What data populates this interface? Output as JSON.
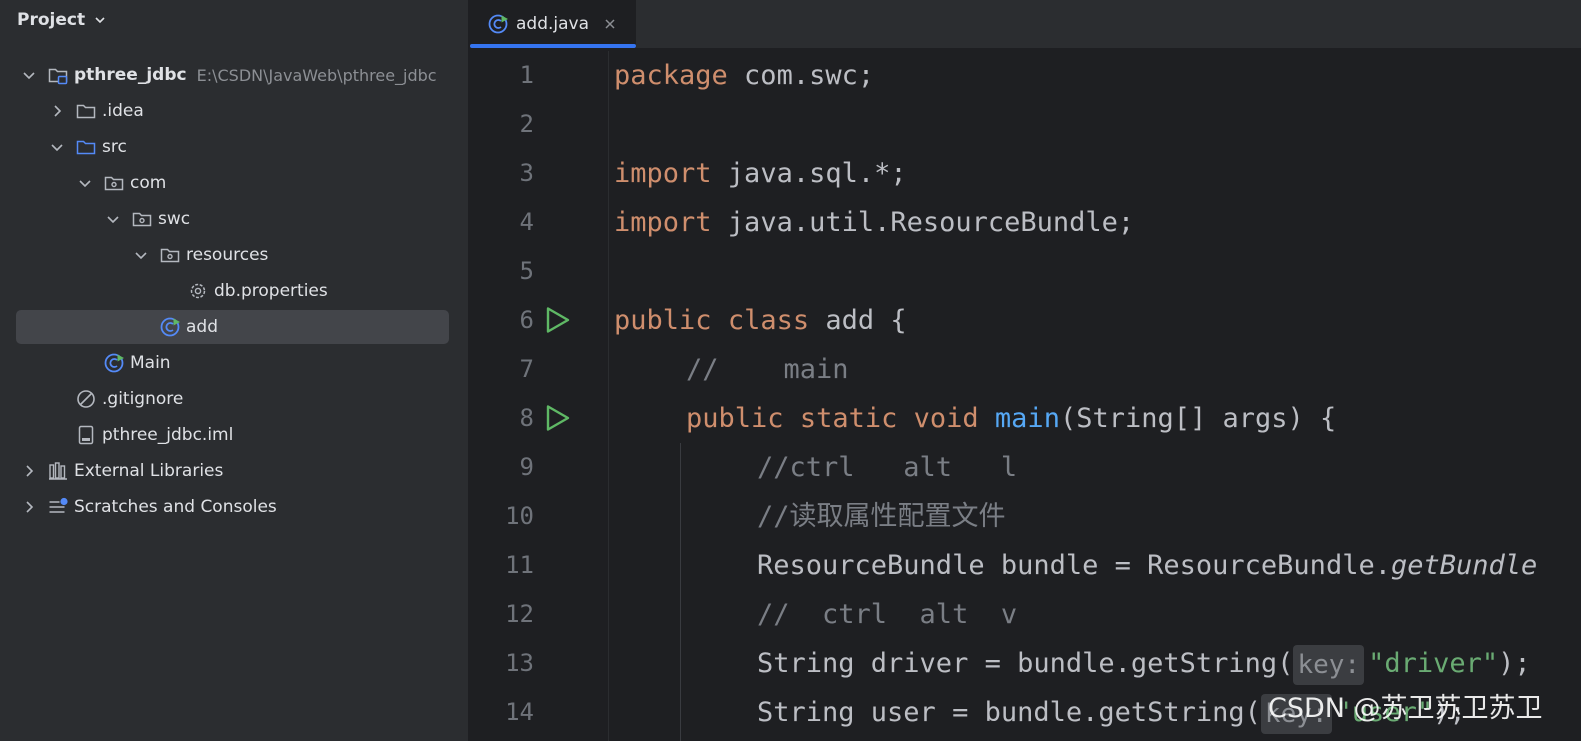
{
  "project_panel": {
    "title": "Project",
    "root": {
      "label": "pthree_jdbc",
      "path": "E:\\CSDN\\JavaWeb\\pthree_jdbc"
    },
    "items": [
      {
        "label": ".idea"
      },
      {
        "label": "src"
      },
      {
        "label": "com"
      },
      {
        "label": "swc"
      },
      {
        "label": "resources"
      },
      {
        "label": "db.properties"
      },
      {
        "label": "add"
      },
      {
        "label": "Main"
      },
      {
        "label": ".gitignore"
      },
      {
        "label": "pthree_jdbc.iml"
      },
      {
        "label": "External Libraries"
      },
      {
        "label": "Scratches and Consoles"
      }
    ],
    "selected_item": "add"
  },
  "editor": {
    "tab": {
      "label": "add.java",
      "icon": "java-class-icon"
    },
    "line_numbers": [
      "1",
      "2",
      "3",
      "4",
      "5",
      "6",
      "7",
      "8",
      "9",
      "10",
      "11",
      "12",
      "13",
      "14"
    ],
    "run_markers_on_lines": [
      6,
      8
    ],
    "code": {
      "l1": {
        "kw": "package",
        "rest": " com.swc;"
      },
      "l3": {
        "kw": "import",
        "rest": " java.sql.*;"
      },
      "l4": {
        "kw": "import",
        "rest": " java.util.ResourceBundle;"
      },
      "l6": {
        "kw1": "public",
        "kw2": "class",
        "rest": " add {"
      },
      "l7": {
        "comment": "//    main"
      },
      "l8": {
        "kw1": "public",
        "kw2": "static",
        "kw3": "void",
        "fn": "main",
        "rest": "(String[] args) {"
      },
      "l9": {
        "comment": "//ctrl   alt   l"
      },
      "l10": {
        "comment": "//读取属性配置文件"
      },
      "l11": {
        "rest": "ResourceBundle bundle = ResourceBundle.",
        "italic": "getBundle"
      },
      "l12": {
        "comment": "//  ctrl  alt  v"
      },
      "l13": {
        "rest": "String driver = bundle.getString(",
        "hint": "key:",
        "str": "\"driver\"",
        "tail": ");"
      },
      "l14": {
        "rest": "String user = bundle.getString(",
        "hint": "key:",
        "str": "\"user\"",
        "tail": ");"
      }
    }
  },
  "watermark": "CSDN @苏卫苏卫苏卫",
  "colors": {
    "panel_bg": "#2b2d30",
    "editor_bg": "#1e1f22",
    "keyword": "#cf8e6d",
    "function": "#56a8f5",
    "comment": "#7a7e85",
    "string": "#6aab73",
    "accent": "#3574f0",
    "folder": "#548af7",
    "run": "#5fb865"
  }
}
